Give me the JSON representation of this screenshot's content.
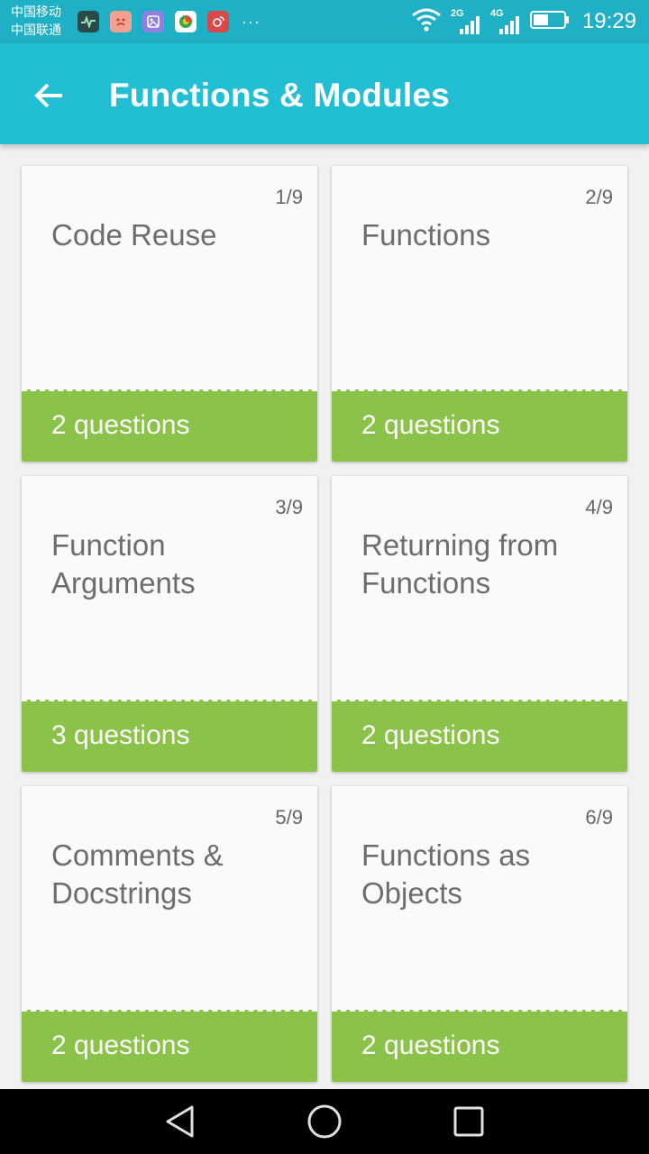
{
  "status_bar": {
    "carrier_1": "中国移动",
    "carrier_2": "中国联通",
    "network_1": "2G",
    "network_2": "4G",
    "time": "19:29",
    "notification_icons": [
      "activity-app-icon",
      "sad-face-app-icon",
      "gallery-app-icon",
      "browser-app-icon",
      "weibo-app-icon"
    ],
    "more_indicator": "···"
  },
  "app_bar": {
    "title": "Functions & Modules",
    "back_icon": "arrow-left-icon",
    "color": "#22bed3"
  },
  "colors": {
    "accent_green": "#8bc34a",
    "card_bg": "#fafafa",
    "title_text": "#6d6d6d"
  },
  "lessons": [
    {
      "number": "1/9",
      "title": "Code Reuse",
      "questions": "2 questions"
    },
    {
      "number": "2/9",
      "title": "Functions",
      "questions": "2 questions"
    },
    {
      "number": "3/9",
      "title": "Function Arguments",
      "questions": "3 questions"
    },
    {
      "number": "4/9",
      "title": "Returning from Functions",
      "questions": "2 questions"
    },
    {
      "number": "5/9",
      "title": "Comments & Docstrings",
      "questions": "2 questions"
    },
    {
      "number": "6/9",
      "title": "Functions as Objects",
      "questions": "2 questions"
    }
  ],
  "nav_bar": {
    "icons": [
      "back-triangle-icon",
      "home-circle-icon",
      "recents-square-icon"
    ]
  }
}
